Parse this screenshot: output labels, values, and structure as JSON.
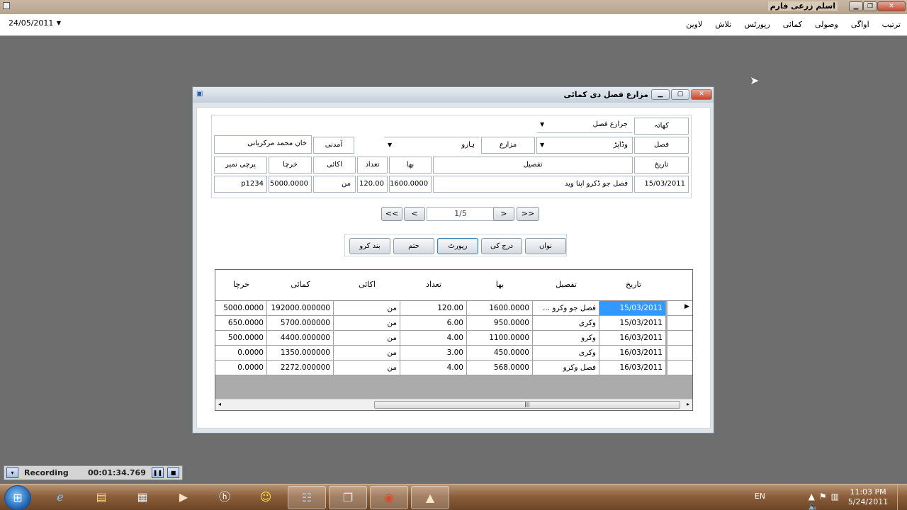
{
  "window": {
    "title": "اسلم زرعی فارم",
    "min_icon": "minimize-icon",
    "max_icon": "maximize-icon",
    "close_icon": "close-icon"
  },
  "toolbar": {
    "date": "24/05/2011",
    "menu": [
      "ترتیب",
      "اواگی",
      "وصولی",
      "کمائی",
      "رپورٹس",
      "تلاش",
      "لاوین"
    ]
  },
  "dialog": {
    "title": "مزارع فصل دی کمائی",
    "form": {
      "khata_label": "کھاتہ",
      "khata_value": "جرارع فصل",
      "fasl_label": "فصل",
      "fasl_value": "وڈاپڑ",
      "mazara_label": "مزارع",
      "mazara_value": "ہارو",
      "aamadani_label": "آمدنی",
      "aamadani_value": "خان محمد مرکریانی",
      "headers": {
        "tareekh": "تاریخ",
        "tafseel": "تفصیل",
        "bha": "بھا",
        "tadaad": "تعداد",
        "ikai": "اکائی",
        "kharcha": "خرچا",
        "parchi": "پرچی نمبر"
      },
      "row": {
        "tareekh": "15/03/2011",
        "tafseel": "فصل جو ڈکرو اپنا وید",
        "bha": "1600.0000",
        "tadaad": "120.00",
        "ikai": "من",
        "kharcha": "5000.0000",
        "parchi": "p1234"
      }
    },
    "navigator": {
      "first": "<<",
      "prev": "<",
      "position": "1/5",
      "next": ">",
      "last": ">>"
    },
    "actions": {
      "new": "نواں",
      "enter": "درج کی",
      "report": "رپورٹ",
      "delete": "ختم",
      "close": "بند کرو"
    },
    "grid": {
      "headers": [
        "تاریخ",
        "تفصیل",
        "بھا",
        "تعداد",
        "اکائی",
        "کمائی",
        "خرچا"
      ],
      "rows": [
        {
          "tareekh": "15/03/2011",
          "tafseel": "فصل جو وکرو ...",
          "bha": "1600.0000",
          "tadaad": "120.00",
          "ikai": "من",
          "kamai": "192000.000000",
          "kharcha": "5000.0000"
        },
        {
          "tareekh": "15/03/2011",
          "tafseel": "وکری",
          "bha": "950.0000",
          "tadaad": "6.00",
          "ikai": "من",
          "kamai": "5700.000000",
          "kharcha": "650.0000"
        },
        {
          "tareekh": "16/03/2011",
          "tafseel": "وکرو",
          "bha": "1100.0000",
          "tadaad": "4.00",
          "ikai": "من",
          "kamai": "4400.000000",
          "kharcha": "500.0000"
        },
        {
          "tareekh": "16/03/2011",
          "tafseel": "وکری",
          "bha": "450.0000",
          "tadaad": "3.00",
          "ikai": "من",
          "kamai": "1350.000000",
          "kharcha": "0.0000"
        },
        {
          "tareekh": "16/03/2011",
          "tafseel": "فصل وکرو",
          "bha": "568.0000",
          "tadaad": "4.00",
          "ikai": "من",
          "kamai": "2272.000000",
          "kharcha": "0.0000"
        }
      ]
    }
  },
  "recording": {
    "label": "Recording",
    "time": "00:01:34.769"
  },
  "taskbar": {
    "lang": "EN",
    "time": "11:03 PM",
    "date": "5/24/2011"
  }
}
